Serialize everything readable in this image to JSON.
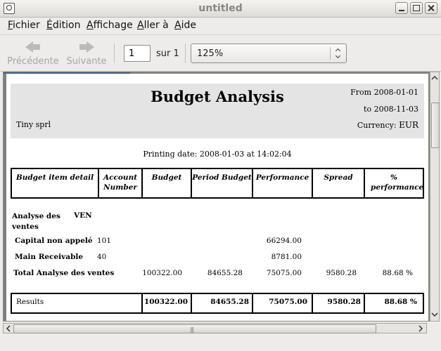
{
  "window": {
    "title": "untitled"
  },
  "menu": [
    "Fichier",
    "Édition",
    "Affichage",
    "Aller à",
    "Aide"
  ],
  "toolbar": {
    "prev_label": "Précédente",
    "next_label": "Suivante",
    "page_value": "1",
    "page_of": "sur 1",
    "zoom": "125%"
  },
  "report": {
    "title": "Budget Analysis",
    "company": "Tiny sprl",
    "date_from": "From 2008-01-01",
    "date_to": "to 2008-11-03",
    "currency_label": "Currency:",
    "currency": "EUR",
    "printing_date": "Printing date: 2008-01-03 at 14:02:04",
    "columns": [
      "Budget item detail",
      "Account Number",
      "Budget",
      "Period Budget",
      "Performance",
      "Spread",
      "% performance"
    ],
    "group": {
      "name": "Analyse des ventes",
      "code": "VEN"
    },
    "rows": [
      {
        "name": "Capital non appelé",
        "account": "101",
        "performance": "66294.00"
      },
      {
        "name": "Main Receivable",
        "account": "40",
        "performance": "8781.00"
      }
    ],
    "total": {
      "label": "Total Analyse des ventes",
      "budget": "100322.00",
      "period_budget": "84655.28",
      "performance": "75075.00",
      "spread": "9580.28",
      "pct": "88.68 %"
    },
    "results": {
      "label": "Results",
      "budget": "100322.00",
      "period_budget": "84655.28",
      "performance": "75075.00",
      "spread": "9580.28",
      "pct": "88.68 %"
    }
  }
}
